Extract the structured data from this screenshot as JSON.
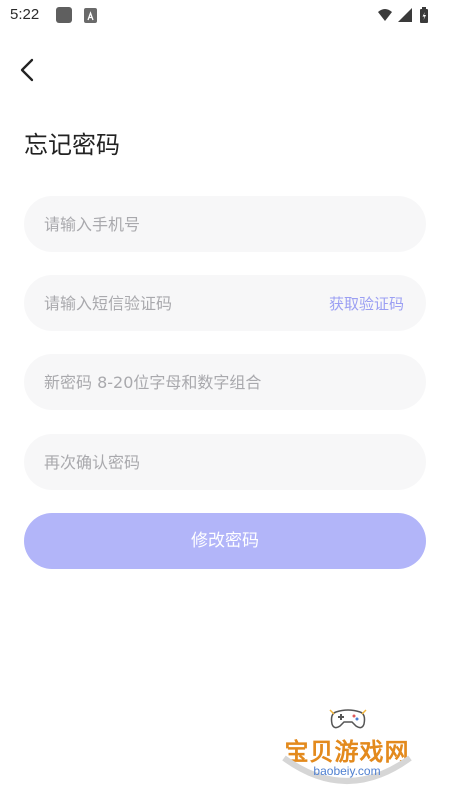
{
  "status_bar": {
    "time": "5:22",
    "icons": [
      "app-icon",
      "font-icon",
      "wifi-icon",
      "signal-icon",
      "battery-icon"
    ]
  },
  "header": {
    "back_icon": "chevron-left-icon",
    "title": "忘记密码"
  },
  "form": {
    "phone": {
      "placeholder": "请输入手机号",
      "value": ""
    },
    "sms_code": {
      "placeholder": "请输入短信验证码",
      "value": "",
      "action_label": "获取验证码"
    },
    "new_password": {
      "placeholder": "新密码 8-20位字母和数字组合",
      "value": ""
    },
    "confirm_password": {
      "placeholder": "再次确认密码",
      "value": ""
    },
    "submit_label": "修改密码"
  },
  "watermark": {
    "brand": "宝贝游戏网",
    "url": "baobeiy.com"
  },
  "colors": {
    "accent": "#b2b5f9",
    "link": "#9b9ff3",
    "field_bg": "#f7f7f8",
    "placeholder": "#a9a9ad",
    "title": "#222222"
  }
}
